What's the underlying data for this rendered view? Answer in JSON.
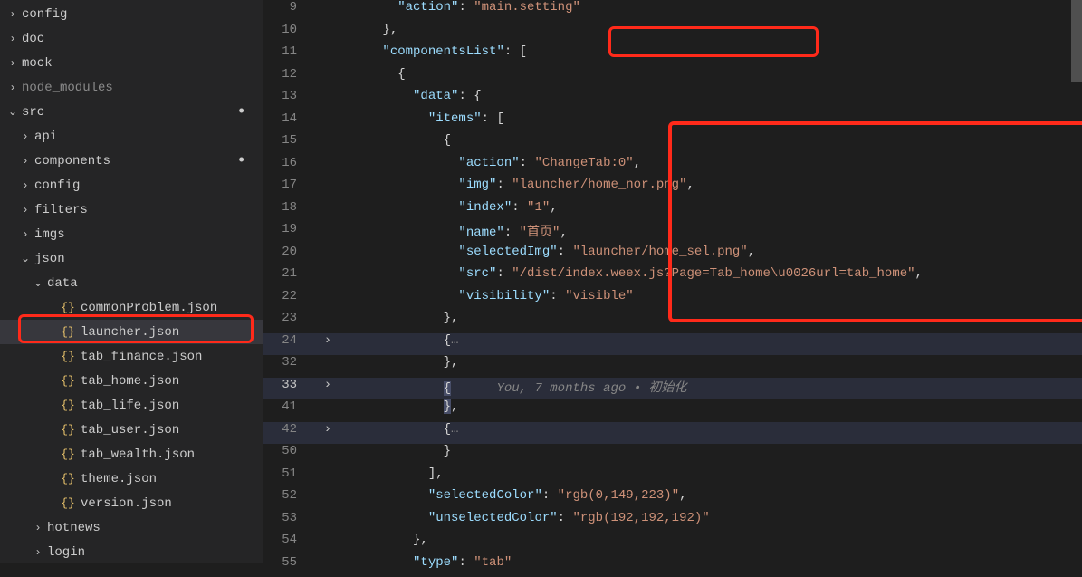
{
  "sidebar": {
    "items": [
      {
        "label": "config",
        "depth": 1,
        "chev": "right"
      },
      {
        "label": "doc",
        "depth": 1,
        "chev": "right"
      },
      {
        "label": "mock",
        "depth": 1,
        "chev": "right"
      },
      {
        "label": "node_modules",
        "depth": 1,
        "chev": "right",
        "dim": true
      },
      {
        "label": "src",
        "depth": 1,
        "chev": "down",
        "dot": true
      },
      {
        "label": "api",
        "depth": 2,
        "chev": "right"
      },
      {
        "label": "components",
        "depth": 2,
        "chev": "right",
        "dot": true
      },
      {
        "label": "config",
        "depth": 2,
        "chev": "right"
      },
      {
        "label": "filters",
        "depth": 2,
        "chev": "right"
      },
      {
        "label": "imgs",
        "depth": 2,
        "chev": "right"
      },
      {
        "label": "json",
        "depth": 2,
        "chev": "down"
      },
      {
        "label": "data",
        "depth": 3,
        "chev": "down"
      },
      {
        "label": "commonProblem.json",
        "depth": 4,
        "file": "json"
      },
      {
        "label": "launcher.json",
        "depth": 4,
        "file": "json",
        "selected": true
      },
      {
        "label": "tab_finance.json",
        "depth": 4,
        "file": "json"
      },
      {
        "label": "tab_home.json",
        "depth": 4,
        "file": "json"
      },
      {
        "label": "tab_life.json",
        "depth": 4,
        "file": "json"
      },
      {
        "label": "tab_user.json",
        "depth": 4,
        "file": "json"
      },
      {
        "label": "tab_wealth.json",
        "depth": 4,
        "file": "json"
      },
      {
        "label": "theme.json",
        "depth": 4,
        "file": "json"
      },
      {
        "label": "version.json",
        "depth": 4,
        "file": "json"
      },
      {
        "label": "hotnews",
        "depth": 3,
        "chev": "right"
      },
      {
        "label": "login",
        "depth": 3,
        "chev": "right"
      }
    ]
  },
  "code_tokens": {
    "action": "\"action\"",
    "main_setting": "\"main.setting\"",
    "componentsList": "\"componentsList\"",
    "data": "\"data\"",
    "items": "\"items\"",
    "changeTab": "\"ChangeTab:0\"",
    "img": "\"img\"",
    "img_v": "\"launcher/home_nor.png\"",
    "index": "\"index\"",
    "index_v": "\"1\"",
    "name": "\"name\"",
    "name_v": "\"首页\"",
    "selectedImg": "\"selectedImg\"",
    "selectedImg_v": "\"launcher/home_sel.png\"",
    "src": "\"src\"",
    "src_v": "\"/dist/index.weex.js?Page=Tab_home\\u0026url=tab_home\"",
    "visibility": "\"visibility\"",
    "visibility_v": "\"visible\"",
    "selectedColor": "\"selectedColor\"",
    "selectedColor_v": "\"rgb(0,149,223)\"",
    "unselectedColor": "\"unselectedColor\"",
    "unselectedColor_v": "\"rgb(192,192,192)\"",
    "type": "\"type\"",
    "type_v": "\"tab\""
  },
  "line_numbers": [
    "9",
    "10",
    "11",
    "12",
    "13",
    "14",
    "15",
    "16",
    "17",
    "18",
    "19",
    "20",
    "21",
    "22",
    "23",
    "24",
    "32",
    "33",
    "41",
    "42",
    "50",
    "51",
    "52",
    "53",
    "54",
    "55"
  ],
  "folds": {
    "r24": "›",
    "r33": "›",
    "r42": "›"
  },
  "blame": {
    "author": "You, ",
    "time": "7 months ago",
    "sep": " • ",
    "msg": "初始化"
  }
}
